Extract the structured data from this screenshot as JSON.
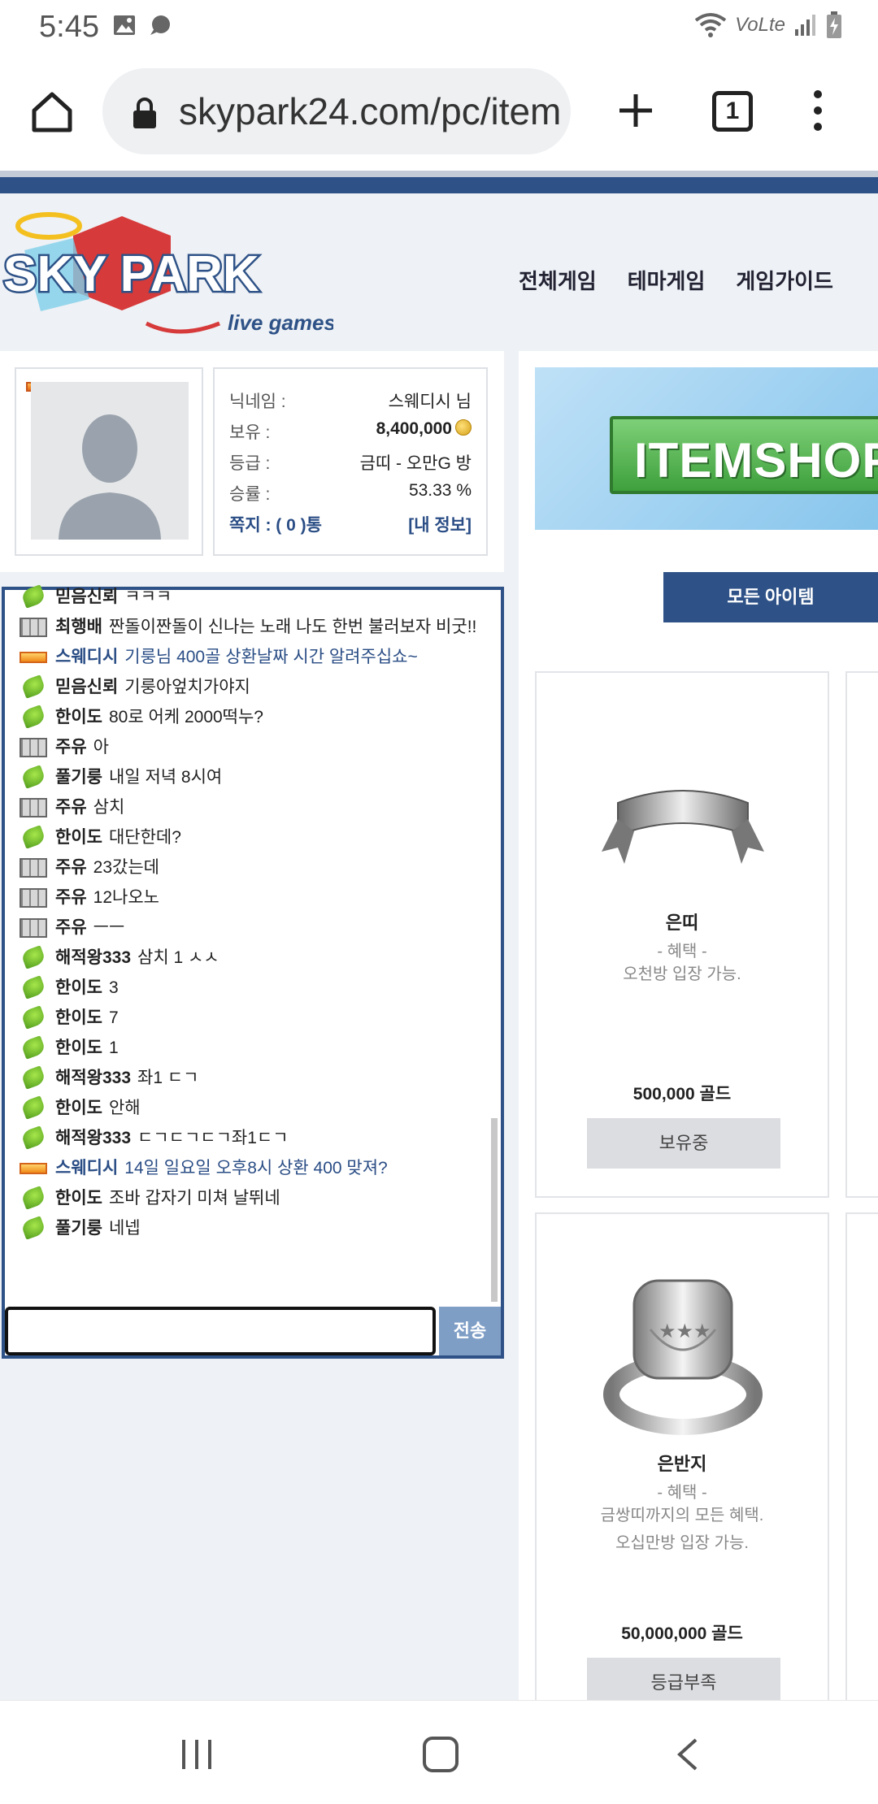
{
  "status_bar": {
    "time": "5:45",
    "network_label": "VoLte"
  },
  "browser": {
    "url": "skypark24.com/pc/item",
    "tab_count": "1"
  },
  "header": {
    "logo_text": "SKY PARK",
    "logo_sub": "live games",
    "nav": [
      "전체게임",
      "테마게임",
      "게임가이드"
    ]
  },
  "profile": {
    "rows": [
      {
        "label": "닉네임 :",
        "value": "스웨디시 님"
      },
      {
        "label": "보유 :",
        "value": "8,400,000"
      },
      {
        "label": "등급 :",
        "value": "금띠 - 오만G 방"
      },
      {
        "label": "승률 :",
        "value": "53.33 %"
      }
    ],
    "messages_link": "쪽지 : ( 0 )통",
    "my_info_link": "[내 정보]"
  },
  "chat": {
    "messages": [
      {
        "icon": "leaf",
        "nick": "믿음신뢰",
        "text": "ㅋㅋㅋ",
        "highlight": false
      },
      {
        "icon": "brick",
        "nick": "최행배",
        "text": "짠돌이짠돌이 신나는 노래 나도 한번 불러보자 비굿!!",
        "highlight": false
      },
      {
        "icon": "gold",
        "nick": "스웨디시",
        "text": "기룽님 400골 상환날짜 시간 알려주십쇼~",
        "highlight": true
      },
      {
        "icon": "leaf",
        "nick": "믿음신뢰",
        "text": "기룽아엎치가야지",
        "highlight": false
      },
      {
        "icon": "leaf",
        "nick": "한이도",
        "text": "80로 어케 2000떡누?",
        "highlight": false
      },
      {
        "icon": "brick",
        "nick": "주유",
        "text": "아",
        "highlight": false
      },
      {
        "icon": "leaf",
        "nick": "풀기룽",
        "text": "내일 저녁 8시여",
        "highlight": false
      },
      {
        "icon": "brick",
        "nick": "주유",
        "text": "삼치",
        "highlight": false
      },
      {
        "icon": "leaf",
        "nick": "한이도",
        "text": "대단한데?",
        "highlight": false
      },
      {
        "icon": "brick",
        "nick": "주유",
        "text": "23갔는데",
        "highlight": false
      },
      {
        "icon": "brick",
        "nick": "주유",
        "text": "12나오노",
        "highlight": false
      },
      {
        "icon": "brick",
        "nick": "주유",
        "text": "ㅡㅡ",
        "highlight": false
      },
      {
        "icon": "leaf",
        "nick": "해적왕333",
        "text": "삼치 1 ㅅㅅ",
        "highlight": false
      },
      {
        "icon": "leaf",
        "nick": "한이도",
        "text": "3",
        "highlight": false
      },
      {
        "icon": "leaf",
        "nick": "한이도",
        "text": "7",
        "highlight": false
      },
      {
        "icon": "leaf",
        "nick": "한이도",
        "text": "1",
        "highlight": false
      },
      {
        "icon": "leaf",
        "nick": "해적왕333",
        "text": "좌1 ㄷㄱ",
        "highlight": false
      },
      {
        "icon": "leaf",
        "nick": "한이도",
        "text": "안해",
        "highlight": false
      },
      {
        "icon": "leaf",
        "nick": "해적왕333",
        "text": "ㄷㄱㄷㄱㄷㄱ좌1ㄷㄱ",
        "highlight": false
      },
      {
        "icon": "gold",
        "nick": "스웨디시",
        "text": "14일 일요일 오후8시 상환 400 맞져?",
        "highlight": true
      },
      {
        "icon": "leaf",
        "nick": "한이도",
        "text": "조바 갑자기 미쳐 날뛰네",
        "highlight": false
      },
      {
        "icon": "leaf",
        "nick": "풀기룽",
        "text": "네넵",
        "highlight": false
      }
    ],
    "input_value": "",
    "send_label": "전송"
  },
  "shop": {
    "banner_text": "ITEMSHOP",
    "all_items_label": "모든 아이템",
    "items": [
      {
        "name": "은띠",
        "benefit_title": "- 혜택 -",
        "benefit_lines": [
          "오천방 입장 가능."
        ],
        "price": "500,000 골드",
        "button": "보유중"
      },
      {
        "name": "은반지",
        "benefit_title": "- 혜택 -",
        "benefit_lines": [
          "금쌍띠까지의 모든 혜택.",
          "오십만방 입장 가능."
        ],
        "price": "50,000,000 골드",
        "button": "등급부족"
      }
    ]
  }
}
